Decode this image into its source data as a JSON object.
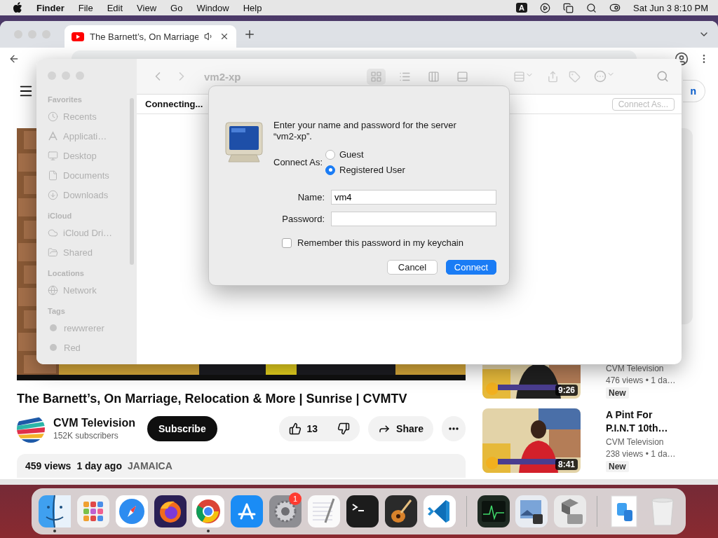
{
  "menu_bar": {
    "app": "Finder",
    "menus": [
      "File",
      "Edit",
      "View",
      "Go",
      "Window",
      "Help"
    ],
    "input_source": "A",
    "clock": "Sat Jun 3  8:10 PM"
  },
  "browser": {
    "tabs": [
      {
        "title": "The Barnett’s, On Marriage",
        "selected": true
      }
    ]
  },
  "youtube": {
    "masthead_button": "n",
    "video": {
      "title": "The Barnett’s, On Marriage, Relocation & More | Sunrise | CVMTV",
      "channel": "CVM Television",
      "subscribers": "152K subscribers",
      "subscribe": "Subscribe",
      "likes": "13",
      "share": "Share",
      "views": "459 views",
      "age": "1 day ago",
      "location": "JAMAICA"
    },
    "recommended": [
      {
        "channel": "CVM Television",
        "meta": "476 views  • 1 da…",
        "badge": "New",
        "duration": "9:26"
      },
      {
        "title": "A Pint For P.I.N.T 10th…",
        "channel": "CVM Television",
        "meta": "238 views  • 1 da…",
        "badge": "New",
        "duration": "8:41"
      }
    ]
  },
  "finder": {
    "title": "vm2-xp",
    "status": "Connecting...",
    "connect_as": "Connect As...",
    "sidebar": [
      {
        "heading": "Favorites",
        "items": [
          {
            "label": "Recents",
            "kind": "clock"
          },
          {
            "label": "Applicati…",
            "kind": "apps"
          },
          {
            "label": "Desktop",
            "kind": "desktop"
          },
          {
            "label": "Documents",
            "kind": "document"
          },
          {
            "label": "Downloads",
            "kind": "download"
          }
        ]
      },
      {
        "heading": "iCloud",
        "items": [
          {
            "label": "iCloud Dri…",
            "kind": "cloud"
          },
          {
            "label": "Shared",
            "kind": "shared"
          }
        ]
      },
      {
        "heading": "Locations",
        "items": [
          {
            "label": "Network",
            "kind": "network"
          }
        ]
      },
      {
        "heading": "Tags",
        "items": [
          {
            "label": "rewwrerer",
            "kind": "tag"
          },
          {
            "label": "Red",
            "kind": "tag"
          }
        ]
      }
    ]
  },
  "dialog": {
    "message": "Enter your name and password for the server “vm2-xp”.",
    "connect_as_label": "Connect As:",
    "options": [
      {
        "label": "Guest",
        "selected": false
      },
      {
        "label": "Registered User",
        "selected": true
      }
    ],
    "name_label": "Name:",
    "name_value": "vm4",
    "password_label": "Password:",
    "remember": {
      "label": "Remember this password in my keychain",
      "checked": false
    },
    "buttons": [
      {
        "label": "Cancel",
        "kind": "default"
      },
      {
        "label": "Connect",
        "kind": "primary"
      }
    ]
  },
  "dock": {
    "items": [
      {
        "kind": "finder",
        "running": true
      },
      {
        "kind": "launchpad",
        "running": false
      },
      {
        "kind": "safari",
        "running": false
      },
      {
        "kind": "firefox",
        "running": false
      },
      {
        "kind": "chrome",
        "running": true
      },
      {
        "kind": "appstore",
        "running": false
      },
      {
        "kind": "settings",
        "running": false,
        "badge": "1"
      },
      {
        "kind": "textedit",
        "running": false
      },
      {
        "kind": "terminal",
        "running": false
      },
      {
        "kind": "guitar",
        "running": false
      },
      {
        "kind": "vscode",
        "running": false
      },
      {
        "kind": "separator"
      },
      {
        "kind": "monitor",
        "running": false
      },
      {
        "kind": "preview",
        "running": false
      },
      {
        "kind": "bootcamp",
        "running": false
      },
      {
        "kind": "separator"
      },
      {
        "kind": "document",
        "running": false
      },
      {
        "kind": "trash",
        "running": false
      }
    ]
  }
}
